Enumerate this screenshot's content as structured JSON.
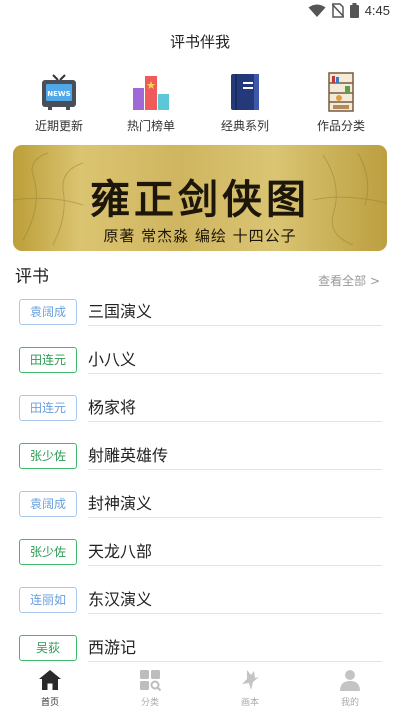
{
  "status_bar": {
    "time": "4:45"
  },
  "app": {
    "title": "评书伴我"
  },
  "quick_nav": [
    {
      "label": "近期更新",
      "icon": "tv-news-icon"
    },
    {
      "label": "热门榜单",
      "icon": "ranking-bars-icon"
    },
    {
      "label": "经典系列",
      "icon": "book-icon"
    },
    {
      "label": "作品分类",
      "icon": "bookshelf-icon"
    }
  ],
  "banner": {
    "title": "雍正剑侠图",
    "subtitle": "原著 常杰淼 编绘 十四公子"
  },
  "section": {
    "title": "评书",
    "more": "查看全部"
  },
  "books": [
    {
      "author": "袁阔成",
      "title": "三国演义",
      "style": "blue"
    },
    {
      "author": "田连元",
      "title": "小八义",
      "style": "green"
    },
    {
      "author": "田连元",
      "title": "杨家将",
      "style": "blue"
    },
    {
      "author": "张少佐",
      "title": "射雕英雄传",
      "style": "green"
    },
    {
      "author": "袁阔成",
      "title": "封神演义",
      "style": "blue"
    },
    {
      "author": "张少佐",
      "title": "天龙八部",
      "style": "green"
    },
    {
      "author": "连丽如",
      "title": "东汉演义",
      "style": "blue"
    },
    {
      "author": "吴荻",
      "title": "西游记",
      "style": "green"
    }
  ],
  "badge_colors": {
    "blue": {
      "border": "#a9c8ef",
      "text": "#6a9fde"
    },
    "green": {
      "border": "#3fba6a",
      "text": "#2a9a52"
    }
  },
  "bottom_nav": [
    {
      "label": "首页",
      "icon": "home-icon",
      "active": true
    },
    {
      "label": "分类",
      "icon": "category-grid-icon",
      "active": false
    },
    {
      "label": "画本",
      "icon": "brush-icon",
      "active": false
    },
    {
      "label": "我的",
      "icon": "profile-icon",
      "active": false
    }
  ]
}
